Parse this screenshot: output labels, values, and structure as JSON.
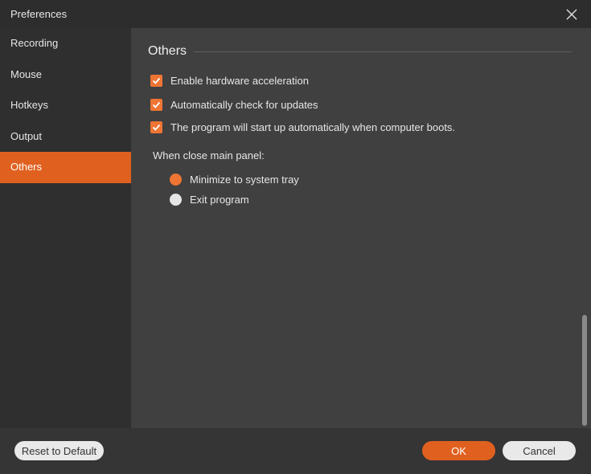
{
  "window": {
    "title": "Preferences"
  },
  "sidebar": {
    "items": [
      {
        "label": "Recording",
        "active": false
      },
      {
        "label": "Mouse",
        "active": false
      },
      {
        "label": "Hotkeys",
        "active": false
      },
      {
        "label": "Output",
        "active": false
      },
      {
        "label": "Others",
        "active": true
      }
    ]
  },
  "content": {
    "section_title": "Others",
    "checkboxes": [
      {
        "label": "Enable hardware acceleration",
        "checked": true
      },
      {
        "label": "Automatically check for updates",
        "checked": true
      },
      {
        "label": "The program will start up automatically when computer boots.",
        "checked": true
      }
    ],
    "close_panel_label": "When close main panel:",
    "radios": [
      {
        "label": "Minimize to system tray",
        "selected": true
      },
      {
        "label": "Exit program",
        "selected": false
      }
    ]
  },
  "footer": {
    "reset_label": "Reset to Default",
    "ok_label": "OK",
    "cancel_label": "Cancel"
  },
  "colors": {
    "accent": "#e0611f",
    "checkbox": "#ee7534",
    "sidebar_bg": "#2f2f2f",
    "content_bg": "#404040"
  }
}
